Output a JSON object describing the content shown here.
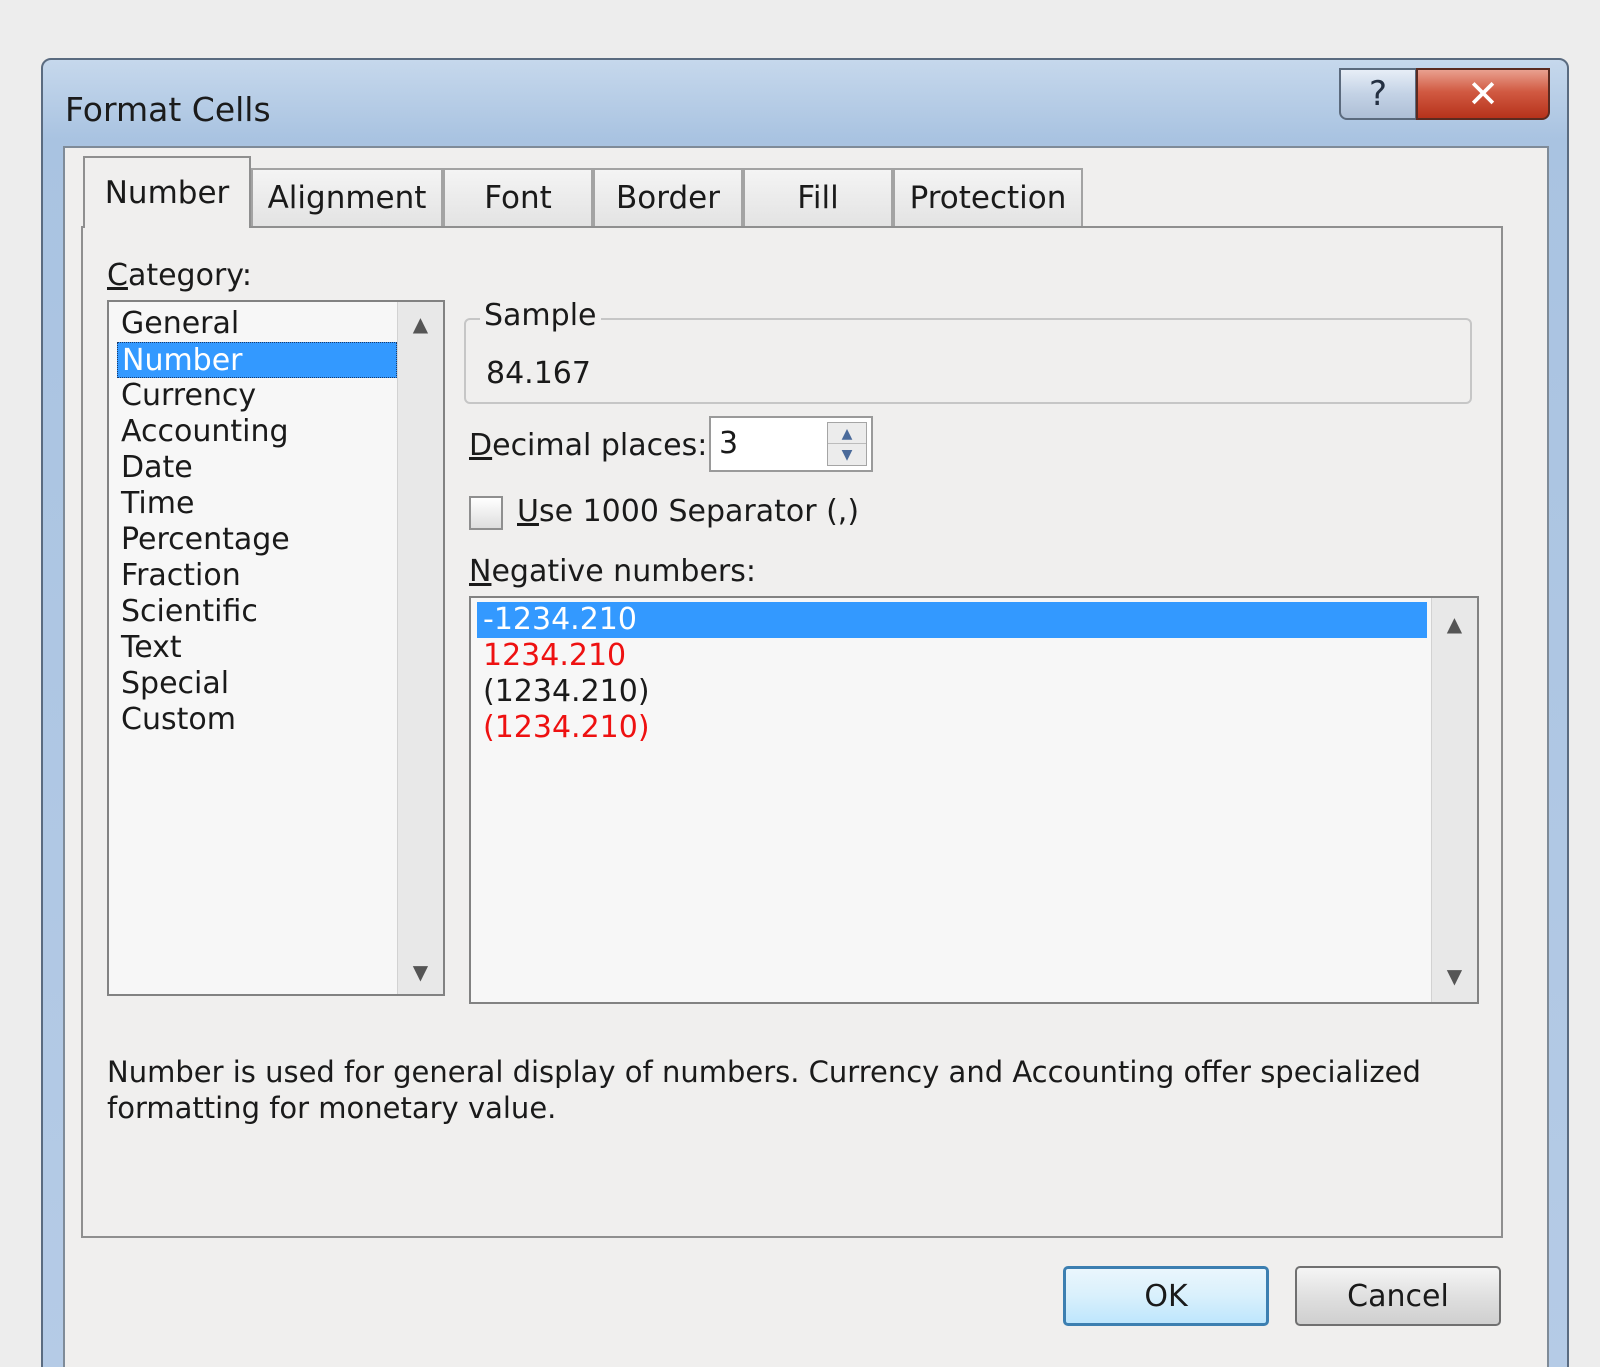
{
  "window": {
    "title": "Format Cells",
    "help_label": "?",
    "close_label": "✕"
  },
  "tabs": [
    {
      "label": "Number",
      "active": true
    },
    {
      "label": "Alignment"
    },
    {
      "label": "Font"
    },
    {
      "label": "Border"
    },
    {
      "label": "Fill"
    },
    {
      "label": "Protection"
    }
  ],
  "category": {
    "label_first": "C",
    "label_rest": "ategory:",
    "items": [
      "General",
      "Number",
      "Currency",
      "Accounting",
      "Date",
      "Time",
      "Percentage",
      "Fraction",
      "Scientific",
      "Text",
      "Special",
      "Custom"
    ],
    "selected": "Number"
  },
  "sample": {
    "legend": "Sample",
    "value": "84.167"
  },
  "decimal_places": {
    "label_first": "D",
    "label_rest": "ecimal places:",
    "value": "3"
  },
  "separator": {
    "label_first": "U",
    "label_rest": "se 1000 Separator (,)",
    "checked": false
  },
  "negative_numbers": {
    "label_first": "N",
    "label_rest": "egative numbers:",
    "items": [
      "-1234.210",
      "1234.210",
      "(1234.210)",
      "(1234.210)"
    ],
    "colors": [
      "#ffffff",
      "#ee1111",
      "#1a1a1a",
      "#ee1111"
    ],
    "selected_index": 0
  },
  "description": "Number is used for general display of numbers.  Currency and Accounting offer specialized formatting for monetary value.",
  "buttons": {
    "ok": "OK",
    "cancel": "Cancel"
  },
  "colors": {
    "selection": "#3399ff",
    "negative_red": "#ee1111",
    "close_button": "#c7432b"
  }
}
